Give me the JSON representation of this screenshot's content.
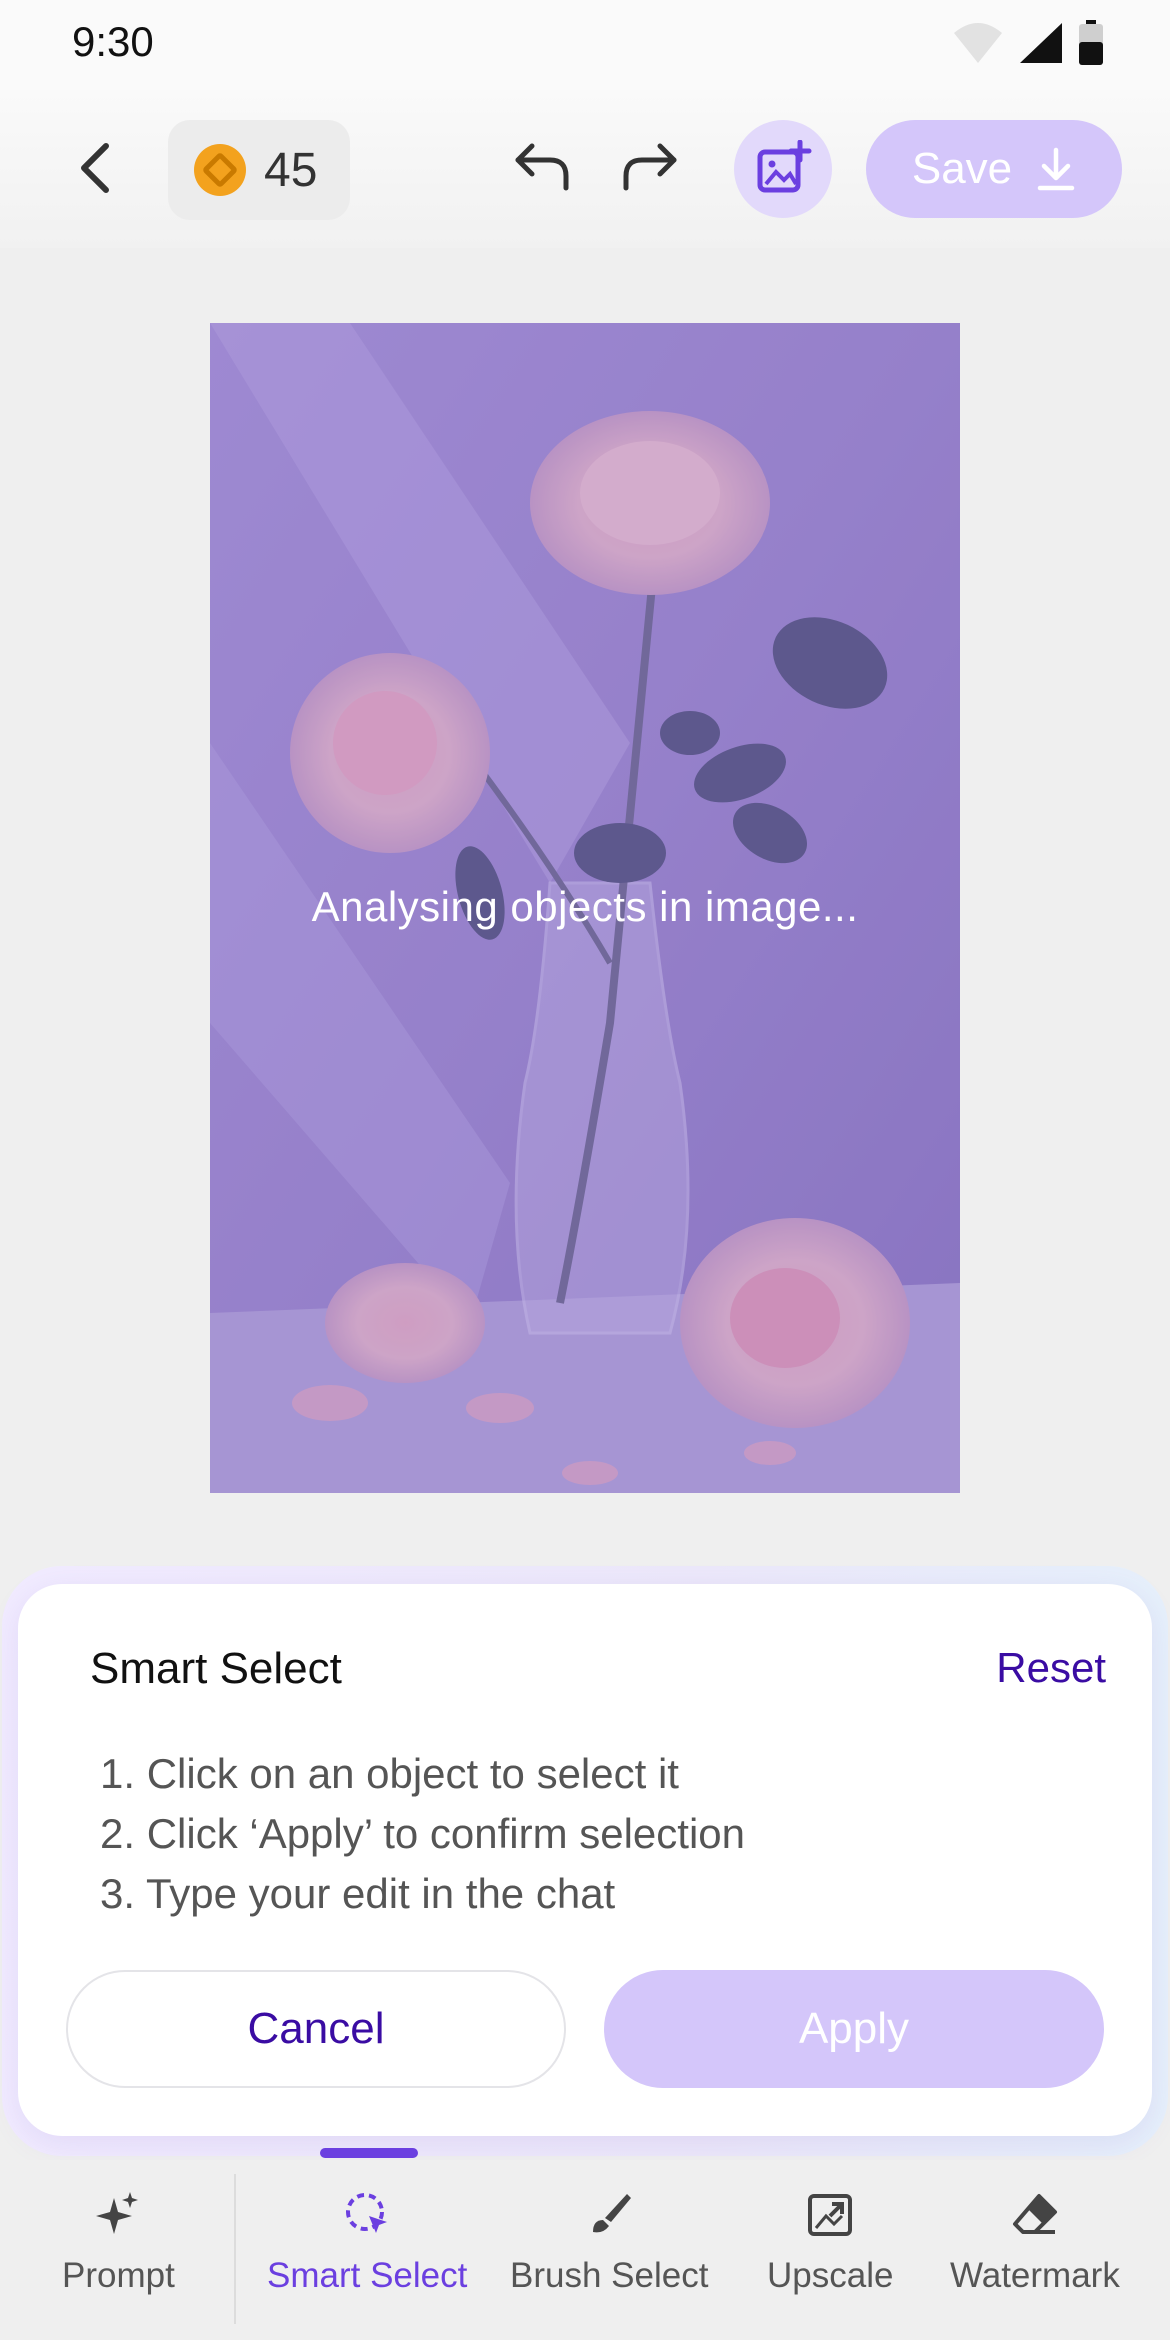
{
  "status_bar": {
    "time": "9:30"
  },
  "header": {
    "credits": "45",
    "save_label": "Save"
  },
  "image": {
    "overlay_text": "Analysing objects in image..."
  },
  "panel": {
    "title": "Smart Select",
    "reset_label": "Reset",
    "steps": [
      "1. Click on an object to select it",
      "2. Click ‘Apply’ to confirm selection",
      "3. Type your edit in the chat"
    ],
    "cancel_label": "Cancel",
    "apply_label": "Apply"
  },
  "bottom_nav": {
    "items": [
      {
        "label": "Prompt",
        "icon": "sparkle-icon"
      },
      {
        "label": "Smart Select",
        "icon": "smart-select-icon",
        "active": true
      },
      {
        "label": "Brush Select",
        "icon": "brush-icon"
      },
      {
        "label": "Upscale",
        "icon": "upscale-icon"
      },
      {
        "label": "Watermark",
        "icon": "eraser-icon"
      }
    ]
  },
  "colors": {
    "accent": "#6b3fe0",
    "accent_dark": "#3a0ca3",
    "accent_light": "#d4c6fa",
    "image_tint": "#8b74c9"
  }
}
